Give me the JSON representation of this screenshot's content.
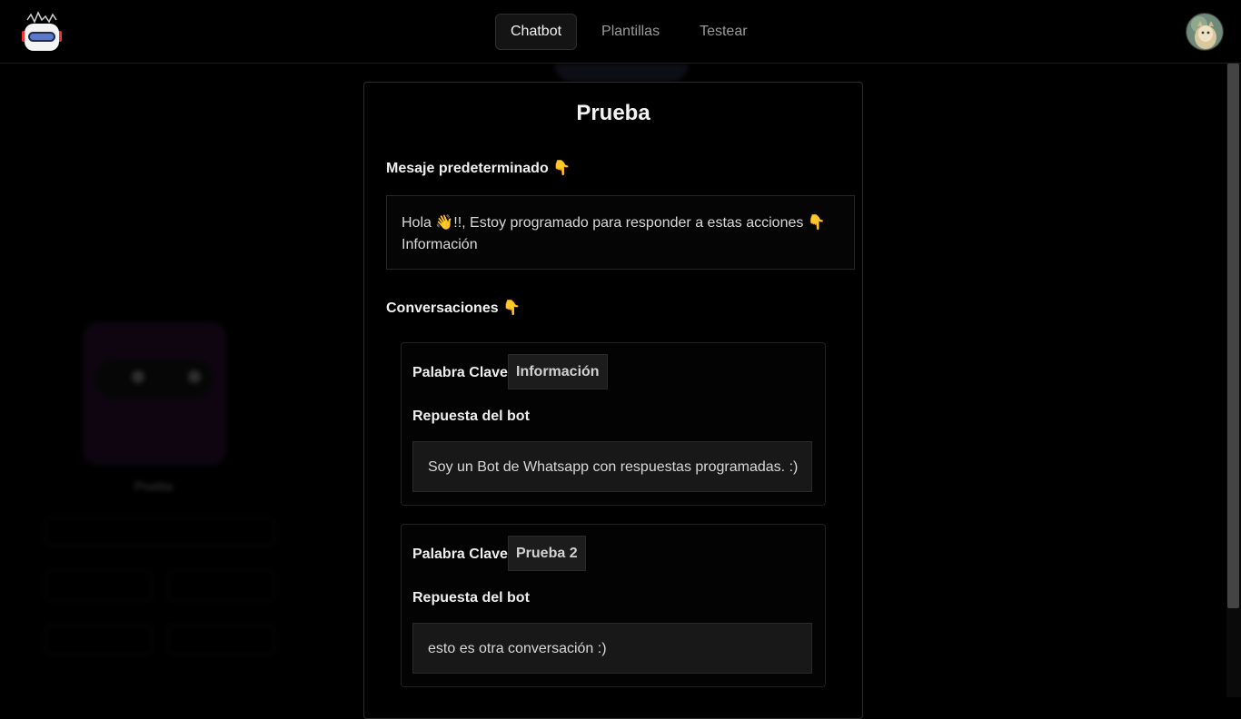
{
  "nav": {
    "tabs": [
      {
        "label": "Chatbot",
        "active": true
      },
      {
        "label": "Plantillas",
        "active": false
      },
      {
        "label": "Testear",
        "active": false
      }
    ]
  },
  "background": {
    "bot_name": "Prueba"
  },
  "modal": {
    "title": "Prueba",
    "default_message_label": "Mesaje predeterminado",
    "default_message_line1": "Hola 👋!!, Estoy programado para responder a estas acciones 👇",
    "default_message_line2": "Información",
    "conversations_label": "Conversaciones",
    "pointing_emoji": "👇",
    "conversations": [
      {
        "keyword_label": "Palabra Clave",
        "keyword": "Información",
        "response_label": "Repuesta del bot",
        "response": "Soy un Bot de Whatsapp con respuestas programadas. :)"
      },
      {
        "keyword_label": "Palabra Clave",
        "keyword": "Prueba 2",
        "response_label": "Repuesta del bot",
        "response": "esto es otra conversación :)"
      }
    ]
  },
  "colors": {
    "background": "#000000",
    "panel_border": "#2c2c2c",
    "input_bg": "#181818",
    "accent_purple": "#1a0a1e"
  },
  "icons": [
    "robot-logo-icon",
    "user-avatar"
  ]
}
